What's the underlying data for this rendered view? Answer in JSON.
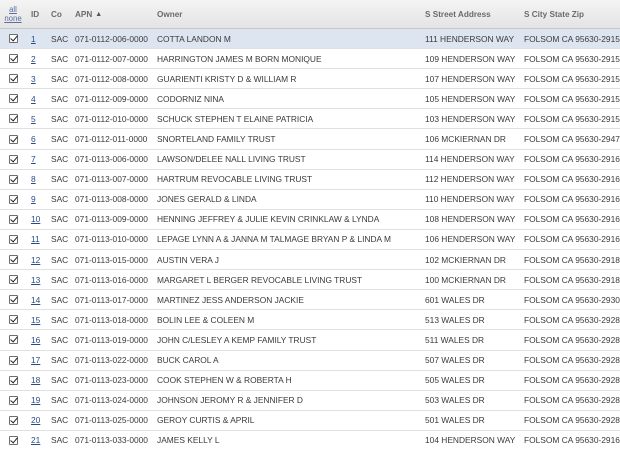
{
  "header": {
    "all_label": "all",
    "none_label": "none",
    "id": "ID",
    "co": "Co",
    "apn": "APN",
    "owner": "Owner",
    "street": "S Street Address",
    "city": "S City State Zip",
    "sort_icon": "chevron-up-icon"
  },
  "rows": [
    {
      "id": "1",
      "co": "SAC",
      "apn": "071-0112-006-0000",
      "owner": "COTTA LANDON M",
      "street": "111 HENDERSON WAY",
      "city": "FOLSOM CA 95630-2915",
      "selected": true
    },
    {
      "id": "2",
      "co": "SAC",
      "apn": "071-0112-007-0000",
      "owner": "HARRINGTON JAMES M BORN MONIQUE",
      "street": "109 HENDERSON WAY",
      "city": "FOLSOM CA 95630-2915"
    },
    {
      "id": "3",
      "co": "SAC",
      "apn": "071-0112-008-0000",
      "owner": "GUARIENTI KRISTY D & WILLIAM R",
      "street": "107 HENDERSON WAY",
      "city": "FOLSOM CA 95630-2915"
    },
    {
      "id": "4",
      "co": "SAC",
      "apn": "071-0112-009-0000",
      "owner": "CODORNIZ NINA",
      "street": "105 HENDERSON WAY",
      "city": "FOLSOM CA 95630-2915"
    },
    {
      "id": "5",
      "co": "SAC",
      "apn": "071-0112-010-0000",
      "owner": "SCHUCK STEPHEN T ELAINE PATRICIA",
      "street": "103 HENDERSON WAY",
      "city": "FOLSOM CA 95630-2915"
    },
    {
      "id": "6",
      "co": "SAC",
      "apn": "071-0112-011-0000",
      "owner": "SNORTELAND FAMILY TRUST",
      "street": "106 MCKIERNAN DR",
      "city": "FOLSOM CA 95630-2947"
    },
    {
      "id": "7",
      "co": "SAC",
      "apn": "071-0113-006-0000",
      "owner": "LAWSON/DELEE NALL LIVING TRUST",
      "street": "114 HENDERSON WAY",
      "city": "FOLSOM CA 95630-2916"
    },
    {
      "id": "8",
      "co": "SAC",
      "apn": "071-0113-007-0000",
      "owner": "HARTRUM REVOCABLE LIVING TRUST",
      "street": "112 HENDERSON WAY",
      "city": "FOLSOM CA 95630-2916"
    },
    {
      "id": "9",
      "co": "SAC",
      "apn": "071-0113-008-0000",
      "owner": "JONES GERALD & LINDA",
      "street": "110 HENDERSON WAY",
      "city": "FOLSOM CA 95630-2916"
    },
    {
      "id": "10",
      "co": "SAC",
      "apn": "071-0113-009-0000",
      "owner": "HENNING JEFFREY & JULIE KEVIN CRINKLAW & LYNDA",
      "street": "108 HENDERSON WAY",
      "city": "FOLSOM CA 95630-2916"
    },
    {
      "id": "11",
      "co": "SAC",
      "apn": "071-0113-010-0000",
      "owner": "LEPAGE LYNN A & JANNA M TALMAGE BRYAN P & LINDA M",
      "street": "106 HENDERSON WAY",
      "city": "FOLSOM CA 95630-2916"
    },
    {
      "id": "12",
      "co": "SAC",
      "apn": "071-0113-015-0000",
      "owner": "AUSTIN VERA J",
      "street": "102 MCKIERNAN DR",
      "city": "FOLSOM CA 95630-2918"
    },
    {
      "id": "13",
      "co": "SAC",
      "apn": "071-0113-016-0000",
      "owner": "MARGARET L BERGER REVOCABLE LIVING TRUST",
      "street": "100 MCKIERNAN DR",
      "city": "FOLSOM CA 95630-2918"
    },
    {
      "id": "14",
      "co": "SAC",
      "apn": "071-0113-017-0000",
      "owner": "MARTINEZ JESS ANDERSON JACKIE",
      "street": "601 WALES DR",
      "city": "FOLSOM CA 95630-2930"
    },
    {
      "id": "15",
      "co": "SAC",
      "apn": "071-0113-018-0000",
      "owner": "BOLIN LEE & COLEEN M",
      "street": "513 WALES DR",
      "city": "FOLSOM CA 95630-2928"
    },
    {
      "id": "16",
      "co": "SAC",
      "apn": "071-0113-019-0000",
      "owner": "JOHN C/LESLEY A KEMP FAMILY TRUST",
      "street": "511 WALES DR",
      "city": "FOLSOM CA 95630-2928"
    },
    {
      "id": "17",
      "co": "SAC",
      "apn": "071-0113-022-0000",
      "owner": "BUCK CAROL A",
      "street": "507 WALES DR",
      "city": "FOLSOM CA 95630-2928"
    },
    {
      "id": "18",
      "co": "SAC",
      "apn": "071-0113-023-0000",
      "owner": "COOK STEPHEN W & ROBERTA H",
      "street": "505 WALES DR",
      "city": "FOLSOM CA 95630-2928"
    },
    {
      "id": "19",
      "co": "SAC",
      "apn": "071-0113-024-0000",
      "owner": "JOHNSON JEROMY R & JENNIFER D",
      "street": "503 WALES DR",
      "city": "FOLSOM CA 95630-2928"
    },
    {
      "id": "20",
      "co": "SAC",
      "apn": "071-0113-025-0000",
      "owner": "GEROY CURTIS & APRIL",
      "street": "501 WALES DR",
      "city": "FOLSOM CA 95630-2928"
    },
    {
      "id": "21",
      "co": "SAC",
      "apn": "071-0113-033-0000",
      "owner": "JAMES KELLY L",
      "street": "104 HENDERSON WAY",
      "city": "FOLSOM CA 95630-2916"
    }
  ]
}
